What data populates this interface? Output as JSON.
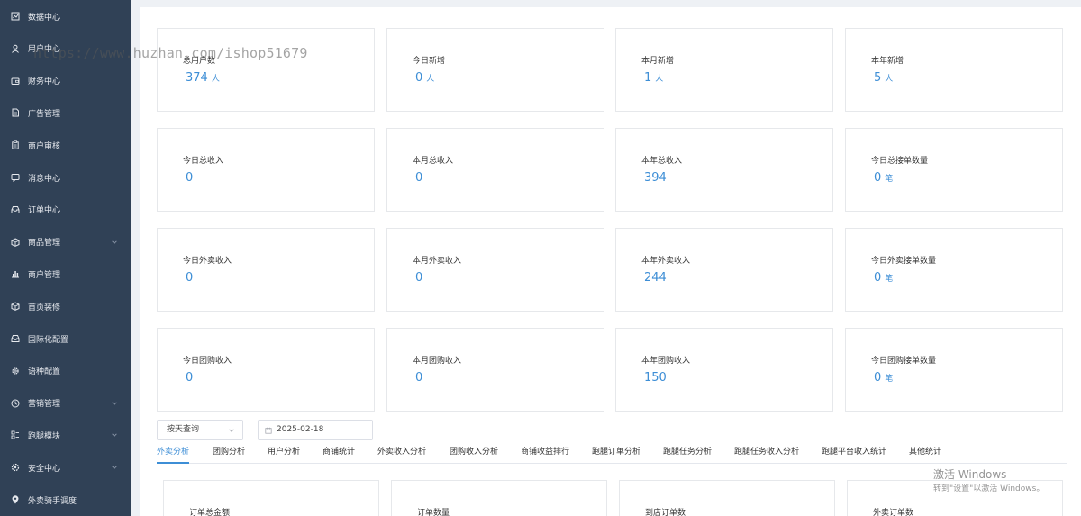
{
  "sidebar": {
    "items": [
      {
        "label": "数据中心",
        "icon": "chart-icon",
        "chevron": false
      },
      {
        "label": "用户中心",
        "icon": "user-icon",
        "chevron": false
      },
      {
        "label": "财务中心",
        "icon": "wallet-icon",
        "chevron": false
      },
      {
        "label": "广告管理",
        "icon": "document-icon",
        "chevron": false
      },
      {
        "label": "商户审核",
        "icon": "clipboard-icon",
        "chevron": false
      },
      {
        "label": "消息中心",
        "icon": "message-icon",
        "chevron": false
      },
      {
        "label": "订单中心",
        "icon": "inbox-icon",
        "chevron": false
      },
      {
        "label": "商品管理",
        "icon": "box-icon",
        "chevron": true
      },
      {
        "label": "商户管理",
        "icon": "bar-chart-icon",
        "chevron": false
      },
      {
        "label": "首页装修",
        "icon": "cube-icon",
        "chevron": false
      },
      {
        "label": "国际化配置",
        "icon": "inbox-icon",
        "chevron": false
      },
      {
        "label": "语种配置",
        "icon": "gear-icon",
        "chevron": false
      },
      {
        "label": "营销管理",
        "icon": "clock-icon",
        "chevron": true
      },
      {
        "label": "跑腿模块",
        "icon": "grid-icon",
        "chevron": true
      },
      {
        "label": "安全中心",
        "icon": "shield-gear-icon",
        "chevron": true
      },
      {
        "label": "外卖骑手调度",
        "icon": "location-icon",
        "chevron": false
      }
    ]
  },
  "stats": {
    "rows": [
      [
        {
          "label": "总用户数",
          "value": "374",
          "unit": "人"
        },
        {
          "label": "今日新增",
          "value": "0",
          "unit": "人"
        },
        {
          "label": "本月新增",
          "value": "1",
          "unit": "人"
        },
        {
          "label": "本年新增",
          "value": "5",
          "unit": "人"
        }
      ],
      [
        {
          "label": "今日总收入",
          "value": "0",
          "unit": ""
        },
        {
          "label": "本月总收入",
          "value": "0",
          "unit": ""
        },
        {
          "label": "本年总收入",
          "value": "394",
          "unit": ""
        },
        {
          "label": "今日总接单数量",
          "value": "0",
          "unit": "笔"
        }
      ],
      [
        {
          "label": "今日外卖收入",
          "value": "0",
          "unit": ""
        },
        {
          "label": "本月外卖收入",
          "value": "0",
          "unit": ""
        },
        {
          "label": "本年外卖收入",
          "value": "244",
          "unit": ""
        },
        {
          "label": "今日外卖接单数量",
          "value": "0",
          "unit": "笔"
        }
      ],
      [
        {
          "label": "今日团购收入",
          "value": "0",
          "unit": ""
        },
        {
          "label": "本月团购收入",
          "value": "0",
          "unit": ""
        },
        {
          "label": "本年团购收入",
          "value": "150",
          "unit": ""
        },
        {
          "label": "今日团购接单数量",
          "value": "0",
          "unit": "笔"
        }
      ]
    ]
  },
  "filters": {
    "query_mode": "按天查询",
    "date": "2025-02-18"
  },
  "tabs": [
    {
      "label": "外卖分析",
      "active": true
    },
    {
      "label": "团购分析",
      "active": false
    },
    {
      "label": "用户分析",
      "active": false
    },
    {
      "label": "商铺统计",
      "active": false
    },
    {
      "label": "外卖收入分析",
      "active": false
    },
    {
      "label": "团购收入分析",
      "active": false
    },
    {
      "label": "商铺收益排行",
      "active": false
    },
    {
      "label": "跑腿订单分析",
      "active": false
    },
    {
      "label": "跑腿任务分析",
      "active": false
    },
    {
      "label": "跑腿任务收入分析",
      "active": false
    },
    {
      "label": "跑腿平台收入统计",
      "active": false
    },
    {
      "label": "其他统计",
      "active": false
    }
  ],
  "bottom_cards": [
    "订单总金额",
    "订单数量",
    "到店订单数",
    "外卖订单数"
  ],
  "overlay": {
    "watermark": "https://www.huzhan.com/ishop51679",
    "activate_title": "激活 Windows",
    "activate_sub": "转到\"设置\"以激活 Windows。"
  },
  "colors": {
    "sidebar_bg": "#304156",
    "accent": "#3d8ed6"
  }
}
